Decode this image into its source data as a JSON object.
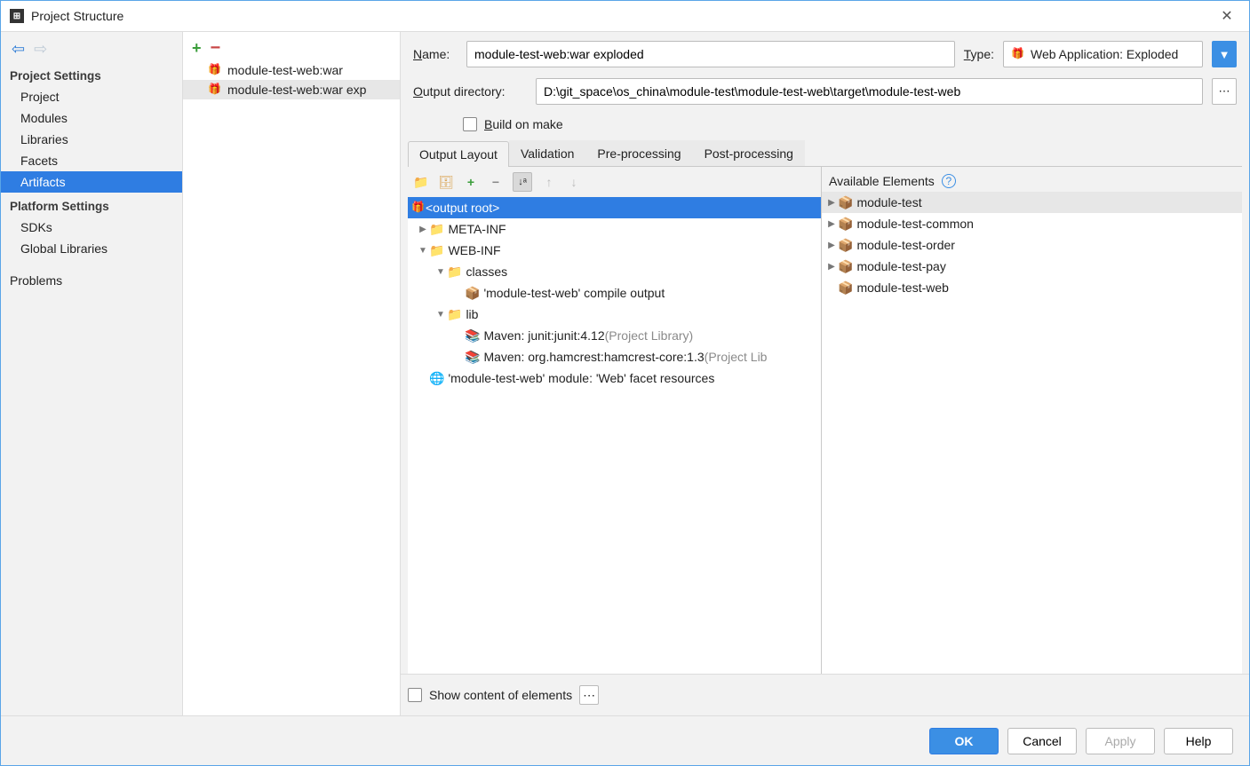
{
  "window": {
    "title": "Project Structure"
  },
  "nav": {
    "section1_label": "Project Settings",
    "section1_items": [
      "Project",
      "Modules",
      "Libraries",
      "Facets",
      "Artifacts"
    ],
    "section2_label": "Platform Settings",
    "section2_items": [
      "SDKs",
      "Global Libraries"
    ],
    "problems_label": "Problems",
    "selected": "Artifacts"
  },
  "artifacts_list": [
    {
      "label": "module-test-web:war"
    },
    {
      "label": "module-test-web:war exp",
      "selected": true
    }
  ],
  "form": {
    "name_label": "Name:",
    "name_value": "module-test-web:war exploded",
    "type_label": "Type:",
    "type_value": "Web Application: Exploded",
    "output_dir_label": "Output directory:",
    "output_dir_value": "D:\\git_space\\os_china\\module-test\\module-test-web\\target\\module-test-web",
    "build_on_make_label": "Build on make"
  },
  "tabs": {
    "items": [
      "Output Layout",
      "Validation",
      "Pre-processing",
      "Post-processing"
    ],
    "active": "Output Layout"
  },
  "output_tree": {
    "root": "<output root>",
    "nodes": {
      "meta_inf": "META-INF",
      "web_inf": "WEB-INF",
      "classes": "classes",
      "classes_content": "'module-test-web' compile output",
      "lib": "lib",
      "lib1_a": "Maven: junit:junit:4.12",
      "lib1_b": " (Project Library)",
      "lib2_a": "Maven: org.hamcrest:hamcrest-core:1.3",
      "lib2_b": " (Project Lib",
      "facet": "'module-test-web' module: 'Web' facet resources"
    }
  },
  "available": {
    "header": "Available Elements",
    "items": [
      "module-test",
      "module-test-common",
      "module-test-order",
      "module-test-pay",
      "module-test-web"
    ]
  },
  "bottom": {
    "show_content_label": "Show content of elements"
  },
  "footer": {
    "ok": "OK",
    "cancel": "Cancel",
    "apply": "Apply",
    "help": "Help"
  }
}
